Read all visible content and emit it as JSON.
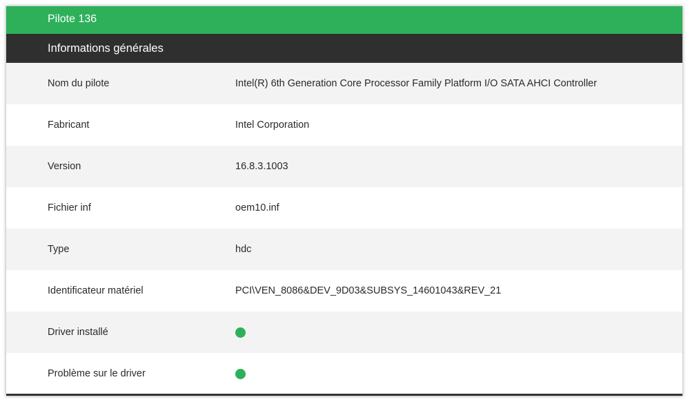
{
  "header": {
    "title": "Pilote 136",
    "section": "Informations générales"
  },
  "colors": {
    "title_bar": "#2eb05a",
    "section_bar": "#2f2f2f",
    "status_ok": "#2eb05a"
  },
  "rows": [
    {
      "label": "Nom du pilote",
      "value": "Intel(R) 6th Generation Core Processor Family Platform I/O SATA AHCI Controller"
    },
    {
      "label": "Fabricant",
      "value": "Intel Corporation"
    },
    {
      "label": "Version",
      "value": "16.8.3.1003"
    },
    {
      "label": "Fichier inf",
      "value": "oem10.inf"
    },
    {
      "label": "Type",
      "value": "hdc"
    },
    {
      "label": "Identificateur matériel",
      "value": "PCI\\VEN_8086&DEV_9D03&SUBSYS_14601043&REV_21"
    },
    {
      "label": "Driver installé",
      "status": "ok",
      "status_icon": "green-dot-icon"
    },
    {
      "label": "Problème sur le driver",
      "status": "ok",
      "status_icon": "green-dot-icon"
    }
  ]
}
